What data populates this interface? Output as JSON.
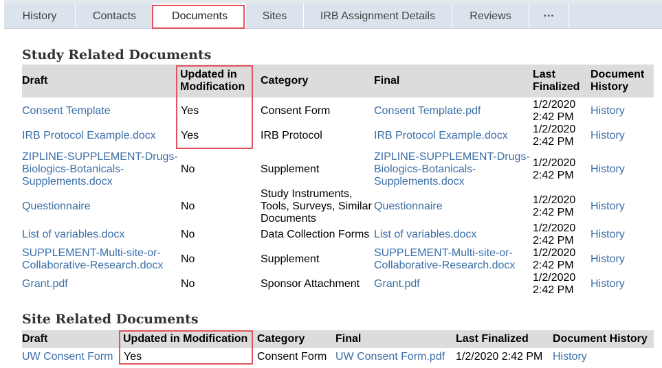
{
  "tabs": [
    "History",
    "Contacts",
    "Documents",
    "Sites",
    "IRB Assignment Details",
    "Reviews",
    "···"
  ],
  "active_tab": "Documents",
  "study_docs": {
    "title": "Study Related Documents",
    "headers": {
      "draft": "Draft",
      "updated": [
        "Updated in",
        "Modification"
      ],
      "category": "Category",
      "final": "Final",
      "last_finalized": [
        "Last",
        "Finalized"
      ],
      "document_history": [
        "Document",
        "History"
      ]
    },
    "rows": [
      {
        "draft": [
          "Consent Template"
        ],
        "updated": "Yes",
        "category": [
          "Consent Form"
        ],
        "final": [
          "Consent Template.pdf"
        ],
        "date": "1/2/2020",
        "time": "2:42 PM",
        "history": "History"
      },
      {
        "draft": [
          "IRB Protocol Example.docx"
        ],
        "updated": "Yes",
        "category": [
          "IRB Protocol"
        ],
        "final": [
          "IRB Protocol Example.docx"
        ],
        "date": "1/2/2020",
        "time": "2:42 PM",
        "history": "History"
      },
      {
        "draft": [
          "ZIPLINE-SUPPLEMENT-Drugs-",
          "Biologics-Botanicals-",
          "Supplements.docx"
        ],
        "updated": "No",
        "category": [
          "Supplement"
        ],
        "final": [
          "ZIPLINE-SUPPLEMENT-Drugs-",
          "Biologics-Botanicals-",
          "Supplements.docx"
        ],
        "date": "1/2/2020",
        "time": "2:42 PM",
        "history": "History"
      },
      {
        "draft": [
          "Questionnaire"
        ],
        "updated": "No",
        "category": [
          "Study Instruments,",
          "Tools, Surveys, Similar",
          "Documents"
        ],
        "final": [
          "Questionnaire"
        ],
        "date": "1/2/2020",
        "time": "2:42 PM",
        "history": "History"
      },
      {
        "draft": [
          "List of variables.docx"
        ],
        "updated": "No",
        "category": [
          "Data Collection Forms"
        ],
        "final": [
          "List of variables.docx"
        ],
        "date": "1/2/2020",
        "time": "2:42 PM",
        "history": "History"
      },
      {
        "draft": [
          "SUPPLEMENT-Multi-site-or-",
          "Collaborative-Research.docx"
        ],
        "updated": "No",
        "category": [
          "Supplement"
        ],
        "final": [
          "SUPPLEMENT-Multi-site-or-",
          "Collaborative-Research.docx"
        ],
        "date": "1/2/2020",
        "time": "2:42 PM",
        "history": "History"
      },
      {
        "draft": [
          "Grant.pdf"
        ],
        "updated": "No",
        "category": [
          "Sponsor Attachment"
        ],
        "final": [
          "Grant.pdf"
        ],
        "date": "1/2/2020",
        "time": "2:42 PM",
        "history": "History"
      }
    ]
  },
  "site_docs": {
    "title": "Site Related Documents",
    "headers": {
      "draft": "Draft",
      "updated": "Updated in Modification",
      "category": "Category",
      "final": "Final",
      "last_finalized": "Last Finalized",
      "document_history": "Document History"
    },
    "rows": [
      {
        "draft": "UW Consent Form",
        "updated": "Yes",
        "category": "Consent Form",
        "final": "UW Consent Form.pdf",
        "last_finalized": "1/2/2020 2:42 PM",
        "history": "History"
      }
    ]
  },
  "colors": {
    "link": "#3a6ea8",
    "highlight": "#e05560",
    "header_bg": "#dcdcdc",
    "tab_bg": "#dbe4ed"
  }
}
